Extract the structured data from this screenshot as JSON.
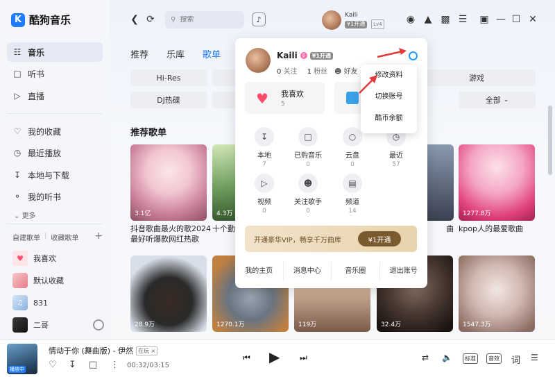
{
  "app": {
    "name": "酷狗音乐",
    "logo_letter": "K",
    "accent": "#1f7cff"
  },
  "sidebar": {
    "nav": [
      {
        "label": "音乐",
        "icon": "music-icon",
        "active": true
      },
      {
        "label": "听书",
        "icon": "book-icon"
      },
      {
        "label": "直播",
        "icon": "live-icon"
      }
    ],
    "library": [
      {
        "label": "我的收藏",
        "icon": "heart-outline-icon"
      },
      {
        "label": "最近播放",
        "icon": "clock-icon"
      },
      {
        "label": "本地与下载",
        "icon": "download-icon"
      },
      {
        "label": "我的听书",
        "icon": "headphones-icon"
      }
    ],
    "more_label": "更多",
    "playlist_tabs": [
      "自建歌单",
      "收藏歌单"
    ],
    "playlists": [
      {
        "label": "我喜欢",
        "color": "#ffe4ea"
      },
      {
        "label": "默认收藏",
        "color": "#f6c8c8"
      },
      {
        "label": "831",
        "color": "#bcd6f2"
      },
      {
        "label": "二哥",
        "color": "#2a2a2a"
      }
    ]
  },
  "topbar": {
    "search_placeholder": "搜索",
    "user_name": "Kaili",
    "vip_label": "¥1开通",
    "level": "Lv4"
  },
  "main": {
    "tabs": [
      {
        "label": "推荐"
      },
      {
        "label": "乐库"
      },
      {
        "label": "歌单",
        "active": true
      }
    ],
    "chips": [
      "Hi-Res",
      "DJ热碟",
      "游戏",
      "全部"
    ],
    "section_title": "推荐歌单",
    "cards_row1": [
      {
        "count": "3.1亿",
        "title": "抖音歌曲最火的歌2024最好听爆款网红热歌",
        "colors": [
          "#f2d6de",
          "#c87d97"
        ]
      },
      {
        "count": "4.3万",
        "title": "十个勤",
        "colors": [
          "#b8d8a0",
          "#5a8a4a"
        ]
      },
      {
        "count": "",
        "title": "曲",
        "colors": [
          "#7a8aa0",
          "#3a4050"
        ]
      },
      {
        "count": "1277.8万",
        "title": "kpop人的最爱歌曲",
        "colors": [
          "#f6c0d6",
          "#e0407a"
        ]
      }
    ],
    "cards_row2": [
      {
        "count": "28.9万",
        "colors": [
          "#d0d8e8",
          "#2a2a2a"
        ]
      },
      {
        "count": "1270.1万",
        "colors": [
          "#7a8a9a",
          "#c08040"
        ]
      },
      {
        "count": "119万",
        "colors": [
          "#d8c0b0",
          "#7a5a4a"
        ]
      },
      {
        "count": "32.4万",
        "colors": [
          "#5a4a40",
          "#1a1210"
        ]
      },
      {
        "count": "1547.3万",
        "colors": [
          "#e0d0cc",
          "#8a6a60"
        ]
      }
    ]
  },
  "popup": {
    "name": "Kaili",
    "vip_label": "¥1开通",
    "following_num": "0",
    "following_label": "关注",
    "fans_num": "1",
    "fans_label": "粉丝",
    "friends_label": "好友",
    "fav_label": "我喜欢",
    "fav_count": "5",
    "grid": [
      {
        "label": "本地",
        "num": "7",
        "icon": "local-download-icon"
      },
      {
        "label": "已购音乐",
        "num": "0",
        "icon": "purchased-icon"
      },
      {
        "label": "云盘",
        "num": "0",
        "icon": "cloud-disk-icon"
      },
      {
        "label": "最近",
        "num": "57",
        "icon": "recent-clock-icon"
      },
      {
        "label": "视频",
        "num": "0",
        "icon": "video-icon"
      },
      {
        "label": "关注歌手",
        "num": "0",
        "icon": "singer-icon"
      },
      {
        "label": "频道",
        "num": "14",
        "icon": "channel-icon"
      }
    ],
    "vip_text": "开通豪华VIP，畅享千万曲库",
    "vip_button": "¥1开通",
    "footer": [
      "我的主页",
      "消息中心",
      "音乐圈",
      "退出账号"
    ]
  },
  "submenu": {
    "items": [
      "修改资料",
      "切换账号",
      "酷币余额"
    ]
  },
  "player": {
    "cover_tag": "播放中",
    "song_title": "情动于你 (舞曲版) - 伊然",
    "playing_tag": "在玩",
    "time": "00:32/03:15",
    "quality_label": "标准",
    "effect_label": "音效",
    "lyrics_label": "词",
    "progress": 0.164
  }
}
